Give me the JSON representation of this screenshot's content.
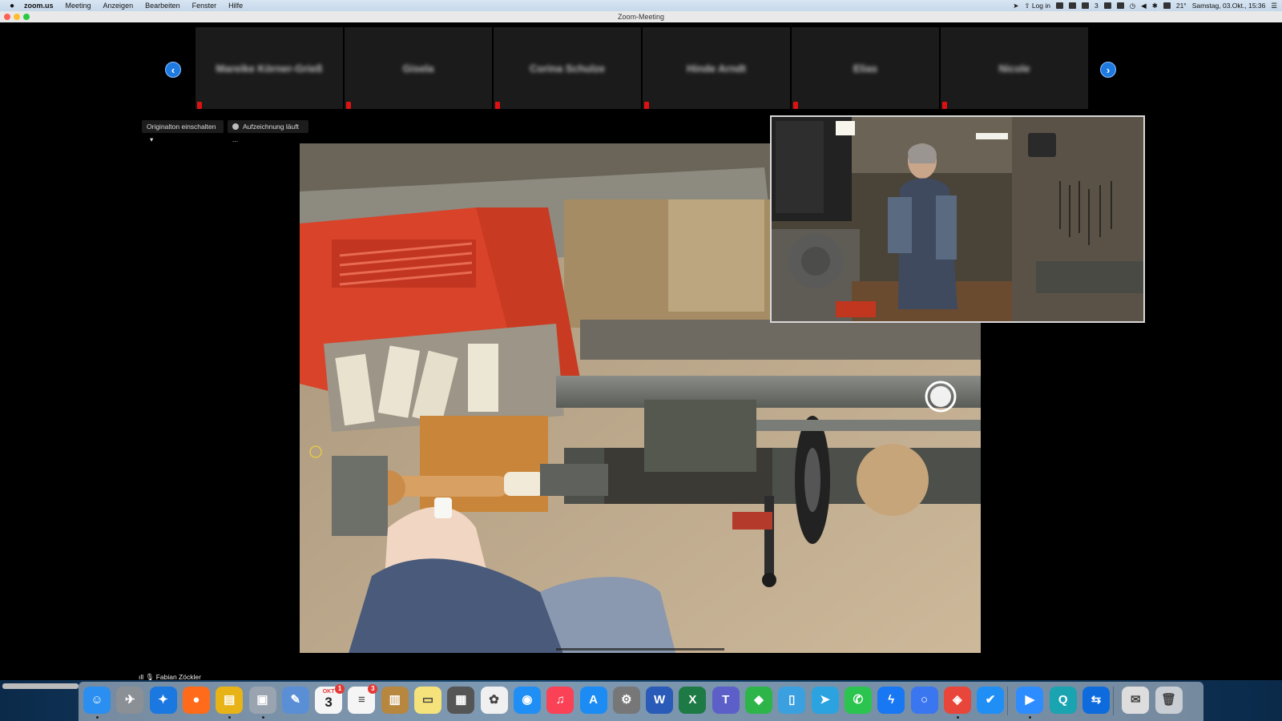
{
  "menubar": {
    "app": "zoom.us",
    "items": [
      "Meeting",
      "Anzeigen",
      "Bearbeiten",
      "Fenster",
      "Hilfe"
    ],
    "login": "Log in",
    "temperature": "21°",
    "clock": "Samstag, 03.Okt., 15:36",
    "notif_count": "3"
  },
  "window": {
    "title": "Zoom-Meeting"
  },
  "controls": {
    "original_sound": "Originalton einschalten",
    "recording": "Aufzeichnung läuft ..."
  },
  "gallery": {
    "participants": [
      "Mareike Körner-Grieß",
      "Gisela",
      "Corina Schulze",
      "Hinde Arndt",
      "Elias",
      "Nicole"
    ]
  },
  "active_speaker": "Fabian Zöckler",
  "dock": {
    "calendar_month": "OKT",
    "calendar_day": "3",
    "calendar_badge": "1",
    "reminders_badge": "3",
    "apps": [
      {
        "name": "finder",
        "glyph": "☺",
        "color": "#2a8ff0"
      },
      {
        "name": "launchpad",
        "glyph": "✈",
        "color": "#8b8f96"
      },
      {
        "name": "safari",
        "glyph": "✦",
        "color": "#1a78e0"
      },
      {
        "name": "firefox",
        "glyph": "●",
        "color": "#ff6b1a"
      },
      {
        "name": "forklift",
        "glyph": "▤",
        "color": "#e8b317"
      },
      {
        "name": "preview",
        "glyph": "▣",
        "color": "#9aa3b0"
      },
      {
        "name": "xcode-tool",
        "glyph": "✎",
        "color": "#5a8fd6"
      },
      {
        "name": "calendar",
        "glyph": "",
        "color": "#f5f5f5"
      },
      {
        "name": "reminders",
        "glyph": "≡",
        "color": "#f5f5f5"
      },
      {
        "name": "notes-book",
        "glyph": "▥",
        "color": "#b7863f"
      },
      {
        "name": "notes",
        "glyph": "▭",
        "color": "#f6e27a"
      },
      {
        "name": "calculator",
        "glyph": "▦",
        "color": "#555"
      },
      {
        "name": "photos",
        "glyph": "✿",
        "color": "#f0f0f0"
      },
      {
        "name": "messages",
        "glyph": "◉",
        "color": "#1f8ff5"
      },
      {
        "name": "music",
        "glyph": "♫",
        "color": "#fa4156"
      },
      {
        "name": "app-store",
        "glyph": "A",
        "color": "#1c8cf4"
      },
      {
        "name": "system-preferences",
        "glyph": "⚙",
        "color": "#777"
      },
      {
        "name": "word",
        "glyph": "W",
        "color": "#2b5bb8"
      },
      {
        "name": "excel",
        "glyph": "X",
        "color": "#1e7a45"
      },
      {
        "name": "teams",
        "glyph": "T",
        "color": "#5b5fc7"
      },
      {
        "name": "evernote",
        "glyph": "◆",
        "color": "#2db54a"
      },
      {
        "name": "notability",
        "glyph": "▯",
        "color": "#3aa0e0"
      },
      {
        "name": "telegram",
        "glyph": "➤",
        "color": "#2aa3e0"
      },
      {
        "name": "whatsapp",
        "glyph": "✆",
        "color": "#2bc44f"
      },
      {
        "name": "messenger",
        "glyph": "ϟ",
        "color": "#1877f2"
      },
      {
        "name": "signal",
        "glyph": "○",
        "color": "#3a76f0"
      },
      {
        "name": "anydesk",
        "glyph": "◈",
        "color": "#e8463a"
      },
      {
        "name": "things",
        "glyph": "✔",
        "color": "#1f8ff5"
      },
      {
        "name": "zoom",
        "glyph": "▶",
        "color": "#2d8cff"
      },
      {
        "name": "qfinder",
        "glyph": "Q",
        "color": "#1aa3b0"
      },
      {
        "name": "teamviewer",
        "glyph": "⇆",
        "color": "#0e6bdd"
      },
      {
        "name": "documents",
        "glyph": "✉",
        "color": "#ddd"
      },
      {
        "name": "trash",
        "glyph": "🗑",
        "color": "#c9ced4"
      }
    ]
  },
  "colors": {
    "accent": "#1f7ae0",
    "mic_muted": "#d11111"
  }
}
